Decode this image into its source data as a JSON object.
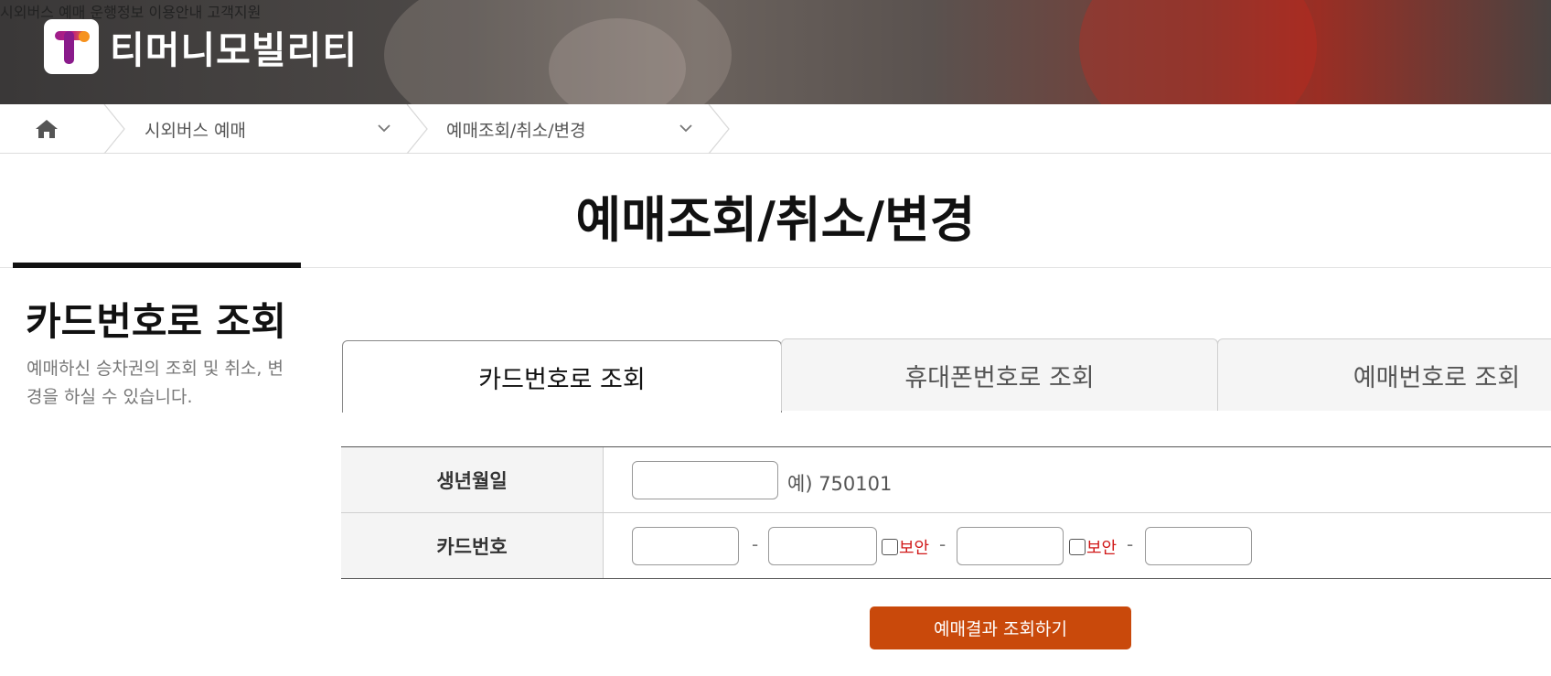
{
  "header": {
    "logo_text": "티머니모빌리티",
    "nav": [
      "시외버스 예매",
      "운행정보",
      "이용안내",
      "고객지원"
    ]
  },
  "breadcrumb": {
    "home_icon": "home-icon",
    "level1": "시외버스 예매",
    "level2": "예매조회/취소/변경"
  },
  "page": {
    "title": "예매조회/취소/변경"
  },
  "side": {
    "title": "카드번호로 조회",
    "description": "예매하신 승차권의 조회 및 취소, 변경을 하실 수 있습니다."
  },
  "tabs": [
    {
      "label": "카드번호로 조회",
      "active": true
    },
    {
      "label": "휴대폰번호로 조회",
      "active": false
    },
    {
      "label": "예매번호로 조회",
      "active": false
    }
  ],
  "form": {
    "birth_label": "생년월일",
    "birth_value": "",
    "birth_hint": "예) 750101",
    "card_label": "카드번호",
    "card_part1": "",
    "card_part2": "",
    "card_part3": "",
    "card_part4": "",
    "security_label": "보안",
    "dash": "-"
  },
  "submit_label": "예매결과 조회하기",
  "colors": {
    "accent": "#c9490b",
    "warning_text": "#d01818"
  }
}
